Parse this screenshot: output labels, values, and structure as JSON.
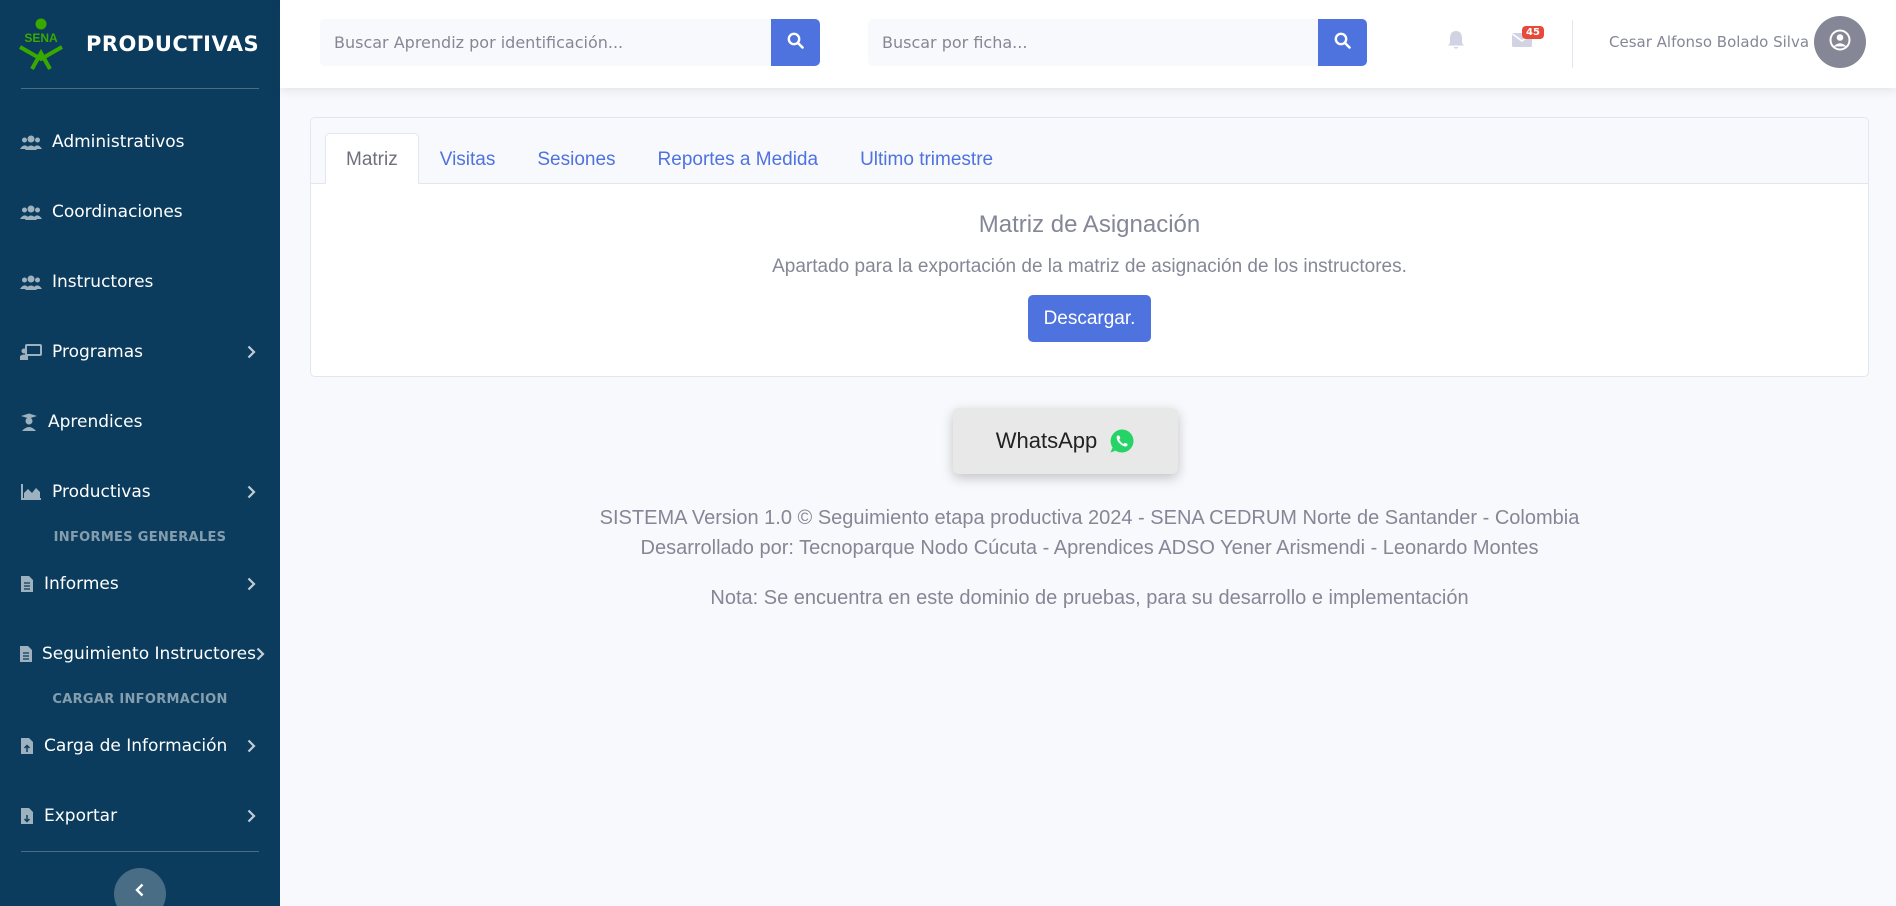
{
  "brand": {
    "logo_text": "SENA",
    "title": "PRODUCTIVAS"
  },
  "sidebar": {
    "items": [
      {
        "label": "Administrativos",
        "icon": "users-icon"
      },
      {
        "label": "Coordinaciones",
        "icon": "users-icon"
      },
      {
        "label": "Instructores",
        "icon": "users-icon"
      },
      {
        "label": "Programas",
        "icon": "chalkboard-icon",
        "expandable": true
      },
      {
        "label": "Aprendices",
        "icon": "graduate-icon"
      },
      {
        "label": "Productivas",
        "icon": "chart-area-icon",
        "expandable": true
      },
      {
        "label": "Informes",
        "icon": "file-icon",
        "expandable": true
      },
      {
        "label": "Seguimiento Instructores",
        "icon": "file-icon",
        "expandable": true
      },
      {
        "label": "Carga de Información",
        "icon": "file-upload-icon",
        "expandable": true
      },
      {
        "label": "Exportar",
        "icon": "file-export-icon",
        "expandable": true
      }
    ],
    "headings": {
      "informes": "INFORMES GENERALES",
      "cargar": "CARGAR INFORMACION"
    }
  },
  "topbar": {
    "search_aprendiz_placeholder": "Buscar Aprendiz por identificación...",
    "search_ficha_placeholder": "Buscar por ficha...",
    "messages_count": "45",
    "user_name": "Cesar Alfonso Bolado Silva"
  },
  "tabs": [
    {
      "label": "Matriz",
      "active": true
    },
    {
      "label": "Visitas"
    },
    {
      "label": "Sesiones"
    },
    {
      "label": "Reportes a Medida"
    },
    {
      "label": "Ultimo trimestre"
    }
  ],
  "panel": {
    "title": "Matriz de Asignación",
    "text": "Apartado para la exportación de la matriz de asignación de los instructores.",
    "button": "Descargar."
  },
  "whatsapp": {
    "label": "WhatsApp"
  },
  "footer": {
    "line1": "SISTEMA Version 1.0 © Seguimiento etapa productiva 2024 - SENA CEDRUM Norte de Santander - Colombia",
    "line2": "Desarrollado por: Tecnoparque Nodo Cúcuta - Aprendices ADSO Yener Arismendi - Leonardo Montes",
    "note": "Nota: Se encuentra en este dominio de pruebas, para su desarrollo e implementación"
  },
  "colors": {
    "sidebar": "#0b3c5d",
    "primary": "#4e73df",
    "logo_green": "#39a900",
    "badge": "#e74a3b",
    "whatsapp_green": "#25d366"
  }
}
